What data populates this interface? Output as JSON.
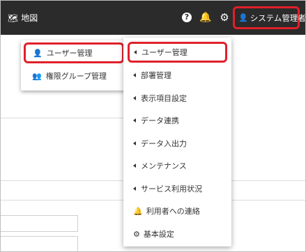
{
  "topbar": {
    "map_label": "地図",
    "help_glyph": "?",
    "user_label": "システム管理者"
  },
  "user_submenu": {
    "items": [
      {
        "label": "ユーザー管理",
        "icon": "user-icon"
      },
      {
        "label": "権限グループ管理",
        "icon": "users-group-icon"
      }
    ]
  },
  "admin_dropdown": {
    "items": [
      {
        "label": "ユーザー管理",
        "icon": "caret-left-icon"
      },
      {
        "label": "部署管理",
        "icon": "caret-left-icon"
      },
      {
        "label": "表示項目設定",
        "icon": "caret-left-icon"
      },
      {
        "label": "データ連携",
        "icon": "caret-left-icon"
      },
      {
        "label": "データ入出力",
        "icon": "caret-left-icon"
      },
      {
        "label": "メンテナンス",
        "icon": "caret-left-icon"
      },
      {
        "label": "サービス利用状況",
        "icon": "caret-left-icon"
      },
      {
        "label": "利用者への連絡",
        "icon": "bell-icon"
      },
      {
        "label": "基本設定",
        "icon": "gear-icon"
      }
    ]
  },
  "colors": {
    "topbar_bg": "#2b2b2b",
    "highlight": "#e0202a"
  }
}
